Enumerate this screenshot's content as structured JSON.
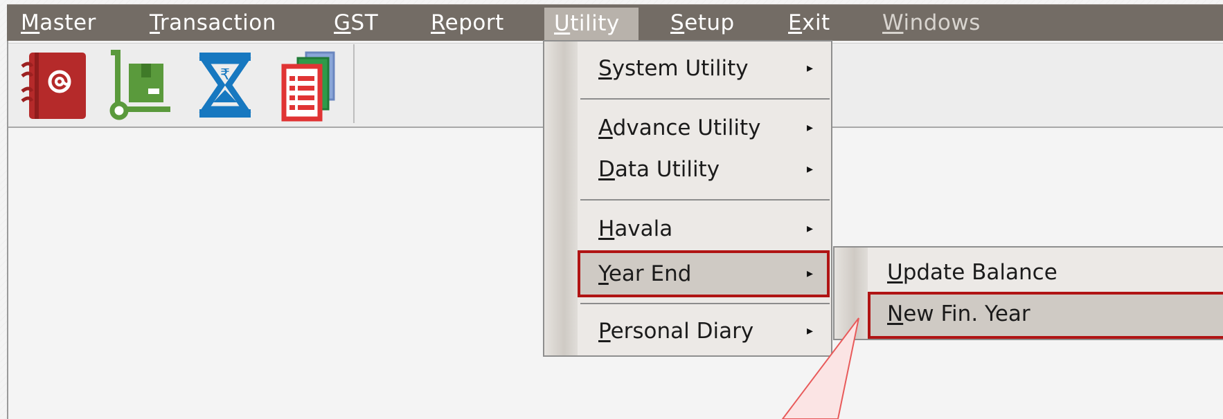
{
  "menubar": {
    "items": [
      {
        "accel": "M",
        "rest": "aster"
      },
      {
        "accel": "T",
        "rest": "ransaction"
      },
      {
        "accel": "G",
        "rest": "ST"
      },
      {
        "accel": "R",
        "rest": "eport"
      },
      {
        "accel": "U",
        "rest": "tility"
      },
      {
        "accel": "S",
        "rest": "etup"
      },
      {
        "accel": "E",
        "rest": "xit"
      },
      {
        "accel": "W",
        "rest": "indows"
      }
    ]
  },
  "toolbar": {
    "buttons": [
      {
        "icon": "address-book-icon"
      },
      {
        "icon": "hand-truck-icon"
      },
      {
        "icon": "hourglass-rupee-icon"
      },
      {
        "icon": "documents-icon"
      }
    ]
  },
  "utility_menu": {
    "items": [
      {
        "accel": "S",
        "rest": "ystem Utility",
        "arrow": "▸"
      },
      {
        "accel": "A",
        "rest": "dvance Utility",
        "arrow": "▸"
      },
      {
        "accel": "D",
        "rest": "ata Utility",
        "arrow": "▸"
      },
      {
        "accel": "H",
        "rest": "avala",
        "arrow": "▸"
      },
      {
        "accel": "Y",
        "rest": "ear End",
        "arrow": "▸"
      },
      {
        "accel": "P",
        "rest": "ersonal Diary",
        "arrow": "▸"
      }
    ]
  },
  "year_end_submenu": {
    "items": [
      {
        "accel": "U",
        "rest": "pdate Balance"
      },
      {
        "accel": "N",
        "rest": "ew Fin. Year"
      }
    ]
  },
  "colors": {
    "menubar": "#736c65",
    "highlight_border": "#b01414",
    "callout": "#e85a5a"
  }
}
